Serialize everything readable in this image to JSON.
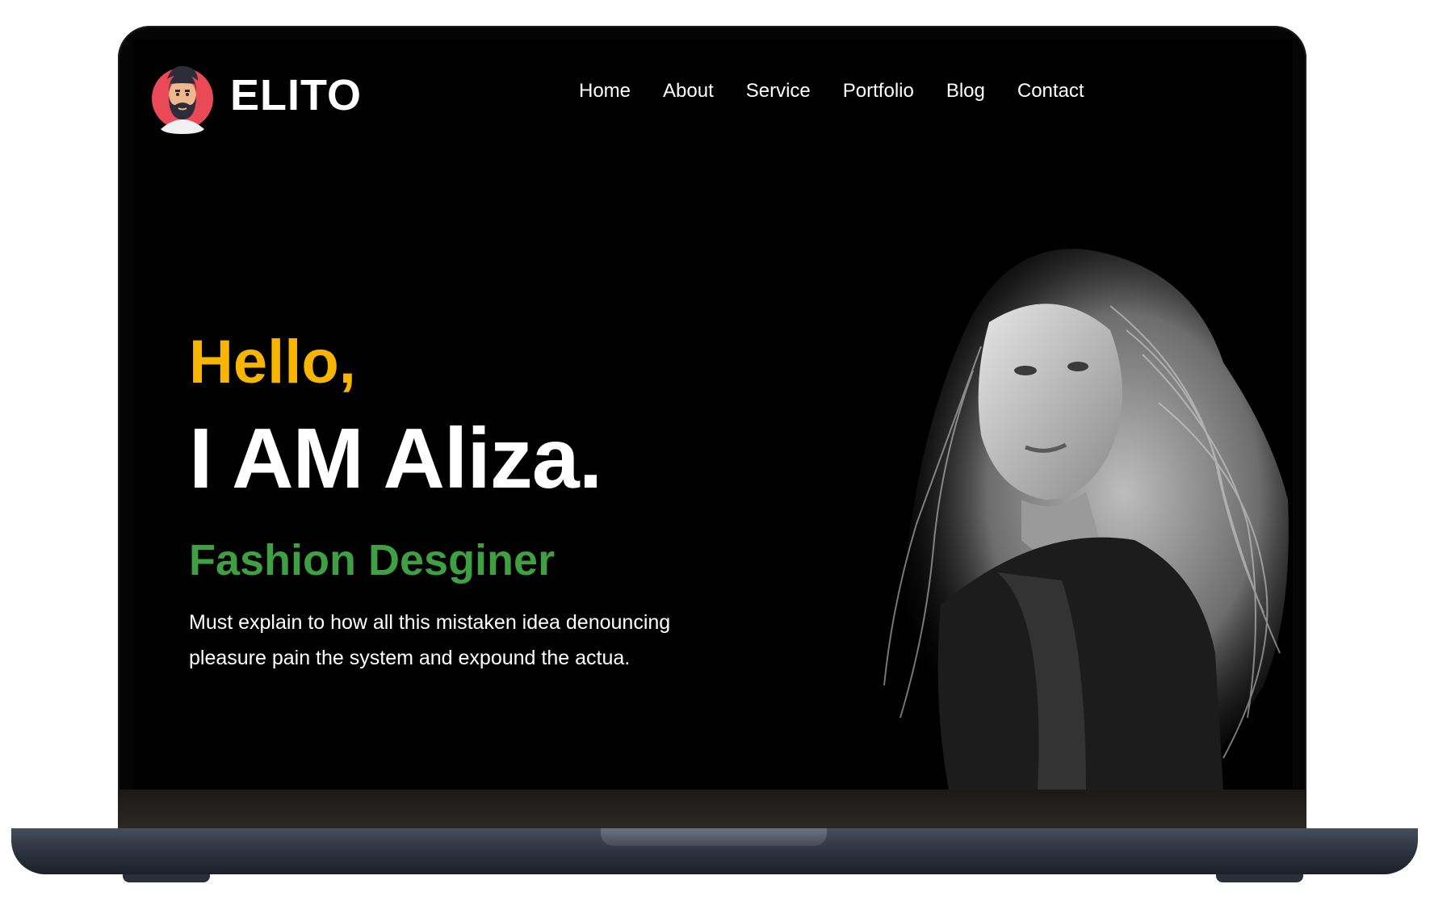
{
  "site": {
    "logo_text": "ELITO",
    "logo_icon": "bearded-man-avatar-icon"
  },
  "nav": {
    "items": [
      {
        "label": "Home"
      },
      {
        "label": "About"
      },
      {
        "label": "Service"
      },
      {
        "label": "Portfolio"
      },
      {
        "label": "Blog"
      },
      {
        "label": "Contact"
      }
    ]
  },
  "hero": {
    "greeting": "Hello,",
    "name": "I AM Aliza.",
    "role": "Fashion Desginer",
    "description": "Must explain to how all this mistaken idea denouncing pleasure pain the system and expound the actua.",
    "image": "woman-portrait-bw"
  },
  "colors": {
    "background": "#000000",
    "greeting": "#f7b500",
    "role": "#3fa043",
    "text": "#ffffff"
  }
}
